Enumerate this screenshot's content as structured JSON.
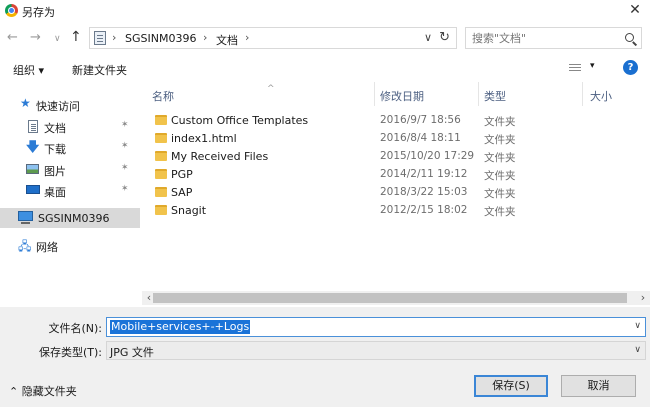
{
  "window": {
    "title": "另存为",
    "close_glyph": "✕"
  },
  "nav": {
    "back": "←",
    "forward": "→",
    "recent": "∨",
    "up": "↑",
    "breadcrumbs": [
      "SGSINM0396",
      "文档"
    ],
    "separator": "›",
    "dropdown": "∨",
    "refresh": "↻",
    "search_placeholder": "搜索\"文档\""
  },
  "toolbar": {
    "organize_label": "组织 ▾",
    "new_folder_label": "新建文件夹",
    "view_caret": "▾",
    "help_label": "?"
  },
  "sidebar": {
    "pin_glyph": "✶",
    "items": [
      {
        "label": "快速访问",
        "icon": "star-icon"
      },
      {
        "label": "文档",
        "icon": "document-icon",
        "pinned": true
      },
      {
        "label": "下载",
        "icon": "download-icon",
        "pinned": true
      },
      {
        "label": "图片",
        "icon": "pictures-icon",
        "pinned": true
      },
      {
        "label": "桌面",
        "icon": "desktop-icon",
        "pinned": true
      },
      {
        "label": "SGSINM0396",
        "icon": "computer-icon",
        "selected": true
      },
      {
        "label": "网络",
        "icon": "network-icon"
      }
    ]
  },
  "filelist": {
    "columns": {
      "name": "名称",
      "modified": "修改日期",
      "type": "类型",
      "size": "大小",
      "sort_glyph": "^"
    },
    "rows": [
      {
        "name": "Custom Office Templates",
        "modified": "2016/9/7 18:56",
        "type": "文件夹"
      },
      {
        "name": "index1.html",
        "modified": "2016/8/4 18:11",
        "type": "文件夹"
      },
      {
        "name": "My Received Files",
        "modified": "2015/10/20 17:29",
        "type": "文件夹"
      },
      {
        "name": "PGP",
        "modified": "2014/2/11 19:12",
        "type": "文件夹"
      },
      {
        "name": "SAP",
        "modified": "2018/3/22 15:03",
        "type": "文件夹"
      },
      {
        "name": "Snagit",
        "modified": "2012/2/15 18:02",
        "type": "文件夹"
      }
    ]
  },
  "scrollbar": {
    "left": "‹",
    "right": "›"
  },
  "bottom": {
    "filename_label": "文件名(N):",
    "filename_value": "Mobile+services+-+Logs",
    "filetype_label": "保存类型(T):",
    "filetype_value": "JPG 文件",
    "dropdown": "∨",
    "hide_folders_label": "⌃  隐藏文件夹",
    "save_label": "保存(S)",
    "cancel_label": "取消"
  }
}
